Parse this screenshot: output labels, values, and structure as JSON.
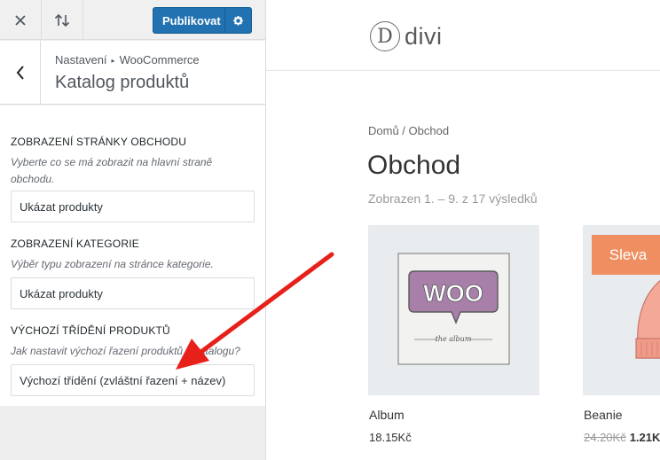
{
  "topbar": {
    "close_icon": "close-icon",
    "sort_icon": "sort-arrows-icon",
    "publish_label": "Publikovat",
    "gear_icon": "gear-icon"
  },
  "section": {
    "breadcrumb_parent": "Nastavení",
    "breadcrumb_separator": "▸",
    "breadcrumb_current": "WooCommerce",
    "title": "Katalog produktů",
    "back_icon": "chevron-left-icon"
  },
  "controls": [
    {
      "label": "ZOBRAZENÍ STRÁNKY OBCHODU",
      "description": "Vyberte co se má zobrazit na hlavní straně obchodu.",
      "value": "Ukázat produkty"
    },
    {
      "label": "ZOBRAZENÍ KATEGORIE",
      "description": "Výběr typu zobrazení na stránce kategorie.",
      "value": "Ukázat produkty"
    },
    {
      "label": "VÝCHOZÍ TŘÍDĚNÍ PRODUKTŮ",
      "description": "Jak nastavit výchozí řazení produktů v katalogu?",
      "value": "Výchozí třídění (zvláštní řazení + název)"
    }
  ],
  "preview": {
    "logo_letter": "D",
    "logo_text": "divi",
    "breadcrumbs": "Domů / Obchod",
    "title": "Obchod",
    "result_count": "Zobrazen 1. – 9. z 17 výsledků",
    "products": [
      {
        "name": "Album",
        "price": "18.15Kč",
        "image_text": "WOO",
        "image_caption": "the album"
      },
      {
        "name": "Beanie",
        "price_old": "24.20Kč",
        "price_new": "1.21K",
        "badge": "Sleva"
      }
    ]
  },
  "colors": {
    "publish": "#2271b1",
    "sale_badge": "#ef8f61",
    "annotation_arrow": "#e8201a"
  }
}
